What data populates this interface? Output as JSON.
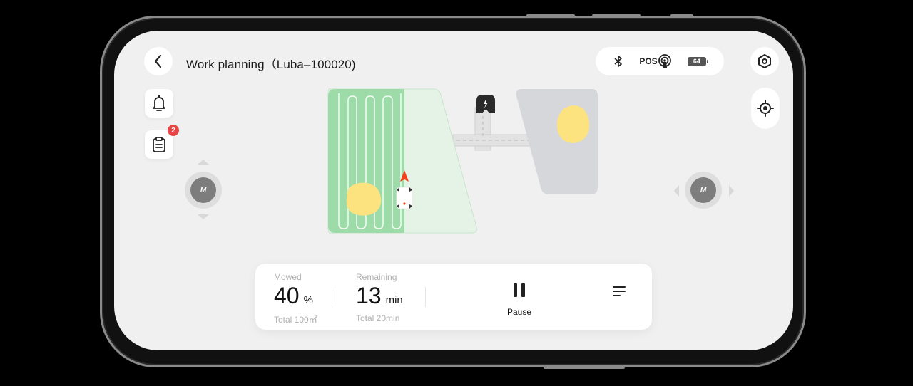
{
  "header": {
    "back_icon": "chevron-left-icon",
    "title": "Work planning（Luba–100020)",
    "status": {
      "bluetooth_icon": "bluetooth-icon",
      "pos_label": "POS",
      "pos_icon": "signal-antenna-icon",
      "battery_level": "64"
    },
    "settings_icon": "hexagon-gear-icon"
  },
  "left_tools": {
    "notification_icon": "bell-icon",
    "tasks_icon": "clipboard-icon",
    "tasks_badge": "2"
  },
  "right_tools": {
    "locate_icon": "crosshair-icon"
  },
  "joysticks": {
    "left_label": "M",
    "right_label": "M"
  },
  "map": {
    "mowed_color": "#9ddca8",
    "unmowed_color": "#e4f3e6",
    "other_zone_color": "#d6d7da",
    "obstacle_color": "#fde37f",
    "heading_color": "#f5401e",
    "charging_station_icon": "charging-dock-icon",
    "mower_icon": "mower-icon"
  },
  "panel": {
    "mowed": {
      "label": "Mowed",
      "value": "40",
      "unit": "%",
      "total": "Total 100㎡"
    },
    "remaining": {
      "label": "Remaining",
      "value": "13",
      "unit": "min",
      "total": "Total 20min"
    },
    "pause_label": "Pause",
    "menu_icon": "menu-lines-icon"
  }
}
